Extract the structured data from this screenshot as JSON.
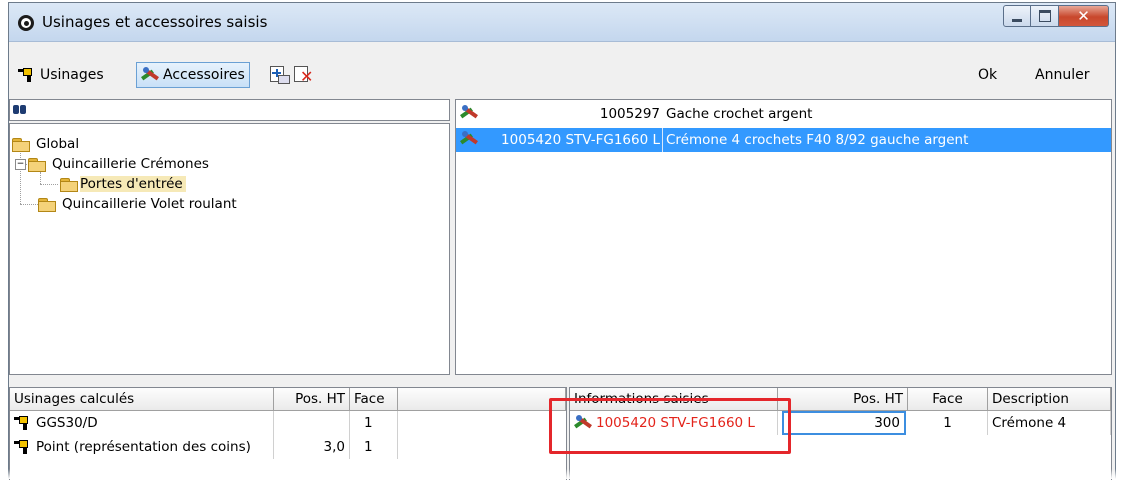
{
  "window": {
    "title": "Usinages et accessoires saisis"
  },
  "toolbar": {
    "usinages_label": "Usinages",
    "accessoires_label": "Accessoires",
    "ok_label": "Ok",
    "cancel_label": "Annuler"
  },
  "tree": {
    "search_value": "",
    "nodes": [
      {
        "label": "Global"
      },
      {
        "label": "Quincaillerie Crémones"
      },
      {
        "label": "Portes d'entrée"
      },
      {
        "label": "Quincaillerie Volet roulant"
      }
    ]
  },
  "accessory_list": [
    {
      "code": "1005297",
      "description": "Gache crochet argent"
    },
    {
      "code": "1005420 STV-FG1660 L",
      "description": "Crémone 4 crochets F40 8/92 gauche argent"
    }
  ],
  "usinages_grid": {
    "headers": [
      "Usinages calculés",
      "Pos. HT",
      "Face",
      ""
    ],
    "rows": [
      {
        "name": "GGS30/D",
        "pos": "",
        "face": "1"
      },
      {
        "name": "Point (représentation des coins)",
        "pos": "3,0",
        "face": "1"
      }
    ]
  },
  "info_grid": {
    "headers": [
      "Informations saisies",
      "Pos. HT",
      "Face",
      "Description"
    ],
    "rows": [
      {
        "name": "1005420 STV-FG1660 L",
        "pos": "300",
        "face": "1",
        "description": "Crémone 4"
      }
    ]
  },
  "colors": {
    "selection": "#3399ff",
    "highlight": "#e4262b",
    "error_text": "#e3241b"
  },
  "icons": [
    "app-icon",
    "drill-icon",
    "accessory-icon",
    "add-icon",
    "delete-icon",
    "binoculars-icon",
    "folder-icon"
  ]
}
